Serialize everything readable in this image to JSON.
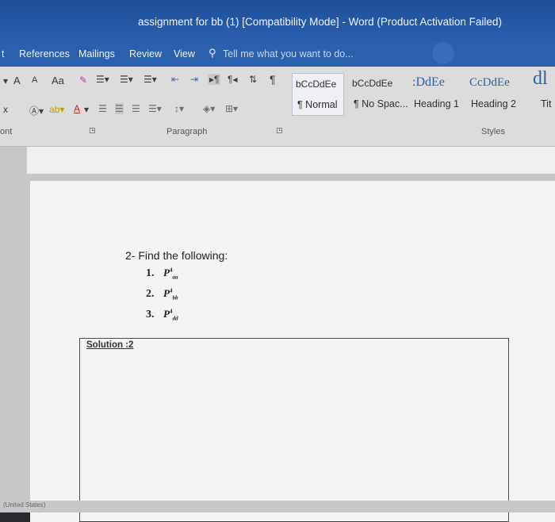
{
  "window": {
    "title": "assignment for bb (1) [Compatibility Mode] - Word (Product Activation Failed)"
  },
  "menu": {
    "items": [
      "t",
      "References",
      "Mailings",
      "Review",
      "View"
    ],
    "tell_me": "Tell me what you want to do..."
  },
  "ribbon": {
    "font_row1": [
      "A",
      "A",
      "Aa"
    ],
    "font_row2": [
      "x",
      "A",
      "A"
    ],
    "styles": [
      {
        "preview": "bCcDdEe",
        "name": "¶ Normal"
      },
      {
        "preview": "bCcDdEe",
        "name": "¶ No Spac..."
      },
      {
        "preview": ":DdEe",
        "name": "Heading 1"
      },
      {
        "preview": "CcDdEe",
        "name": "Heading 2"
      },
      {
        "preview": "dl",
        "name": "Tit"
      }
    ],
    "group_labels": {
      "font": "ont",
      "paragraph": "Paragraph",
      "styles": "Styles"
    }
  },
  "document": {
    "question": "2- Find the following:",
    "items": [
      {
        "num": "1.",
        "sup": "4",
        "sub": "aa"
      },
      {
        "num": "2.",
        "sup": "4",
        "sub": "bb"
      },
      {
        "num": "3.",
        "sup": "4",
        "sub": "dd"
      }
    ],
    "p_symbol": "P",
    "solution_label": "Solution :2"
  },
  "status": {
    "language": "(United States)"
  }
}
